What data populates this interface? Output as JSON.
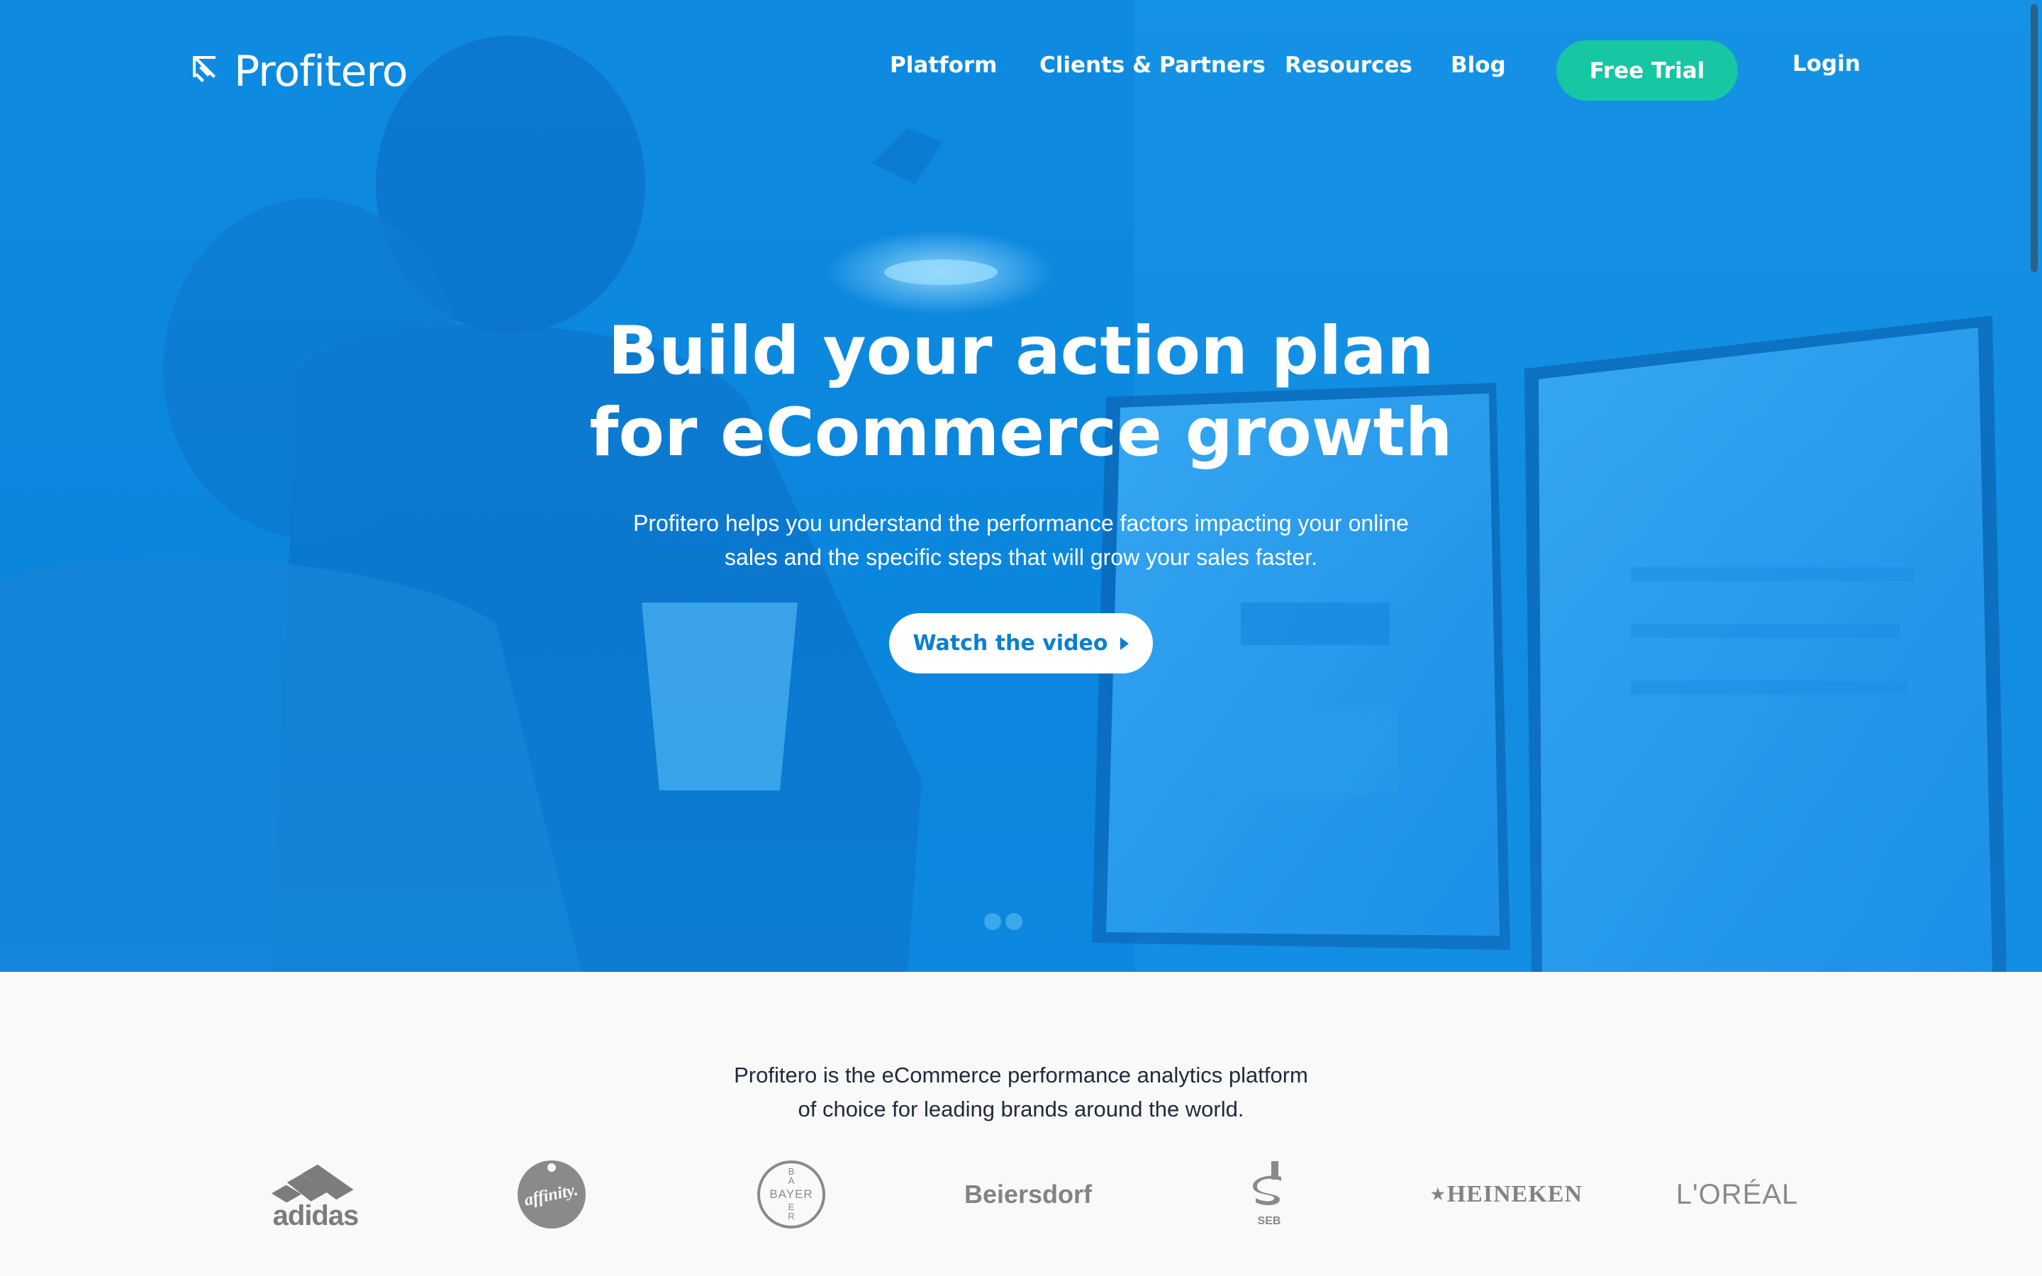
{
  "nav": {
    "logo_text": "Profitero",
    "links": [
      "Platform",
      "Clients & Partners",
      "Resources",
      "Blog"
    ],
    "cta": "Free Trial",
    "login": "Login"
  },
  "hero": {
    "headline_line1": "Build your action plan",
    "headline_line2": "for eCommerce growth",
    "subtext_line1": "Profitero helps you understand the performance factors impacting your online",
    "subtext_line2": "sales and the specific steps that will grow your sales faster.",
    "button": "Watch the video"
  },
  "trust": {
    "text_line1": "Profitero is the eCommerce performance analytics platform",
    "text_line2": "of choice for leading brands around the world.",
    "brands": [
      "adidas",
      "affinity",
      "BAYER",
      "Beiersdorf",
      "SEB",
      "HEINEKEN",
      "L'ORÉAL"
    ]
  },
  "colors": {
    "hero_blue": "#0a86dd",
    "cta_green": "#17c6a3",
    "button_text_blue": "#0a7fd0",
    "brand_gray": "#7c7c7c"
  }
}
